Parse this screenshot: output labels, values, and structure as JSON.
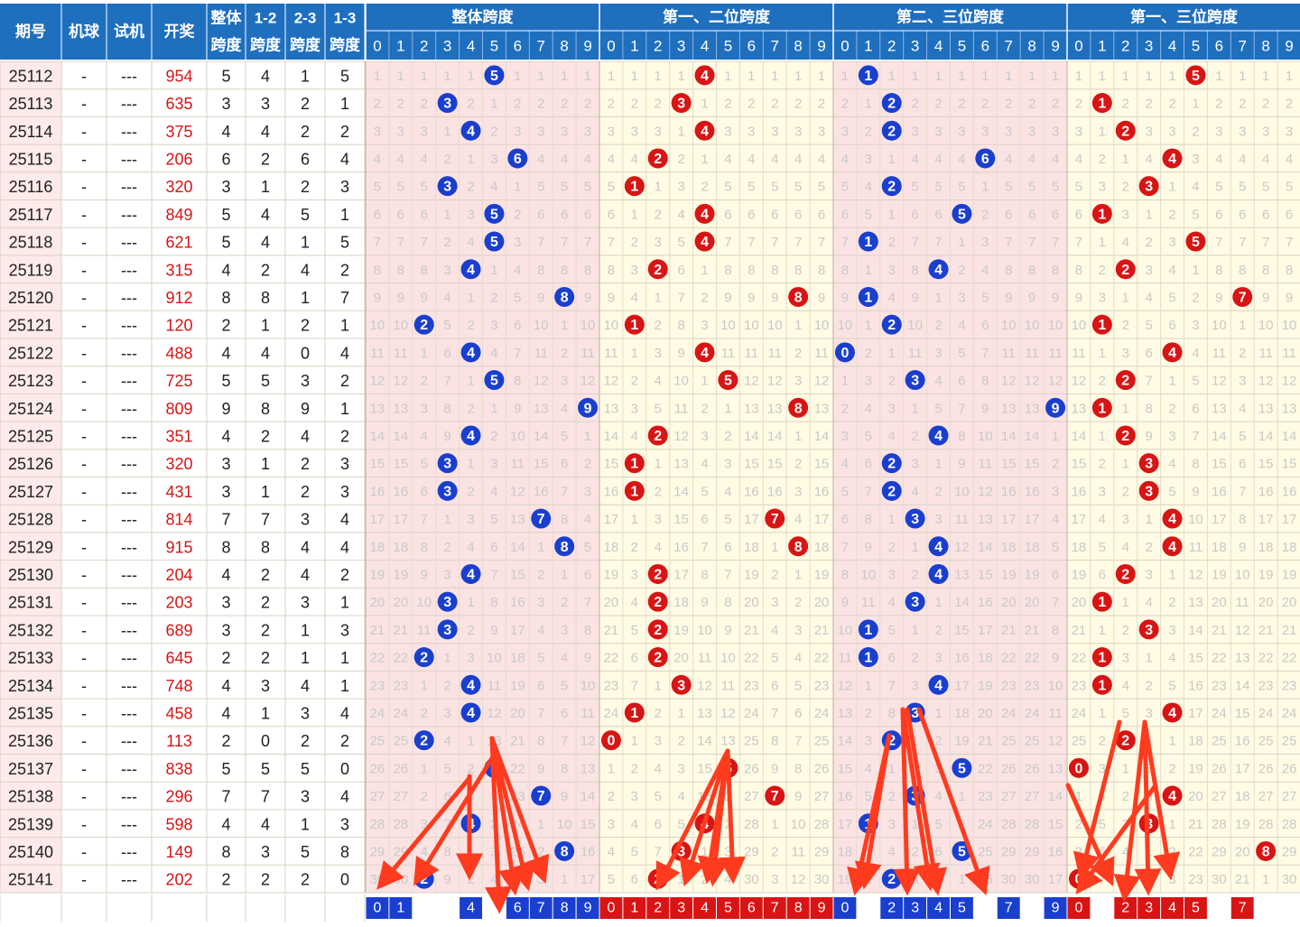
{
  "header": {
    "period": "期号",
    "machine": "机球",
    "trial": "试机",
    "draw": "开奖",
    "overall_span": "整体跨度",
    "span12": "1-2跨度",
    "span23": "2-3跨度",
    "span13": "1-3跨度",
    "group_titles": [
      "整体跨度",
      "第一、二位跨度",
      "第二、三位跨度",
      "第一、三位跨度"
    ],
    "digits": [
      "0",
      "1",
      "2",
      "3",
      "4",
      "5",
      "6",
      "7",
      "8",
      "9"
    ]
  },
  "colors": {
    "header_bg": "#1f6fbf",
    "header_text": "#ffffff",
    "left_col_bg": "#fdeaea",
    "cell_bg_a": "#fbe3e3",
    "cell_bg_b": "#fffbe4",
    "miss_text": "#c9c9c9",
    "blue_ball": "#1a3fcf",
    "red_ball": "#d81414",
    "arrow": "#ff3b1f",
    "draw_text": "#d81414"
  },
  "chart_data": {
    "type": "table",
    "periods": [
      "25112",
      "25113",
      "25114",
      "25115",
      "25116",
      "25117",
      "25118",
      "25119",
      "25120",
      "25121",
      "25122",
      "25123",
      "25124",
      "25125",
      "25126",
      "25127",
      "25128",
      "25129",
      "25130",
      "25131",
      "25132",
      "25133",
      "25134",
      "25135",
      "25136",
      "25137",
      "25138",
      "25139",
      "25140",
      "25141"
    ],
    "machine": [
      "-",
      "-",
      "-",
      "-",
      "-",
      "-",
      "-",
      "-",
      "-",
      "-",
      "-",
      "-",
      "-",
      "-",
      "-",
      "-",
      "-",
      "-",
      "-",
      "-",
      "-",
      "-",
      "-",
      "-",
      "-",
      "-",
      "-",
      "-",
      "-",
      "-"
    ],
    "trial": [
      "---",
      "---",
      "---",
      "---",
      "---",
      "---",
      "---",
      "---",
      "---",
      "---",
      "---",
      "---",
      "---",
      "---",
      "---",
      "---",
      "---",
      "---",
      "---",
      "---",
      "---",
      "---",
      "---",
      "---",
      "---",
      "---",
      "---",
      "---",
      "---",
      "---"
    ],
    "draws": [
      "954",
      "635",
      "375",
      "206",
      "320",
      "849",
      "621",
      "315",
      "912",
      "120",
      "488",
      "725",
      "809",
      "351",
      "320",
      "431",
      "814",
      "915",
      "204",
      "203",
      "689",
      "645",
      "748",
      "458",
      "113",
      "838",
      "296",
      "598",
      "149",
      "202"
    ],
    "overall_span": [
      5,
      3,
      4,
      6,
      3,
      5,
      5,
      4,
      8,
      2,
      4,
      5,
      9,
      4,
      3,
      3,
      7,
      8,
      4,
      3,
      3,
      2,
      4,
      4,
      2,
      5,
      7,
      4,
      8,
      2
    ],
    "span_12": [
      4,
      3,
      4,
      2,
      1,
      4,
      4,
      2,
      8,
      1,
      4,
      5,
      8,
      2,
      1,
      1,
      7,
      8,
      2,
      2,
      2,
      2,
      3,
      1,
      0,
      5,
      7,
      4,
      3,
      2
    ],
    "span_23": [
      1,
      2,
      2,
      6,
      2,
      5,
      1,
      4,
      1,
      2,
      0,
      3,
      9,
      4,
      2,
      2,
      3,
      4,
      4,
      3,
      1,
      1,
      4,
      3,
      2,
      5,
      3,
      1,
      5,
      2
    ],
    "span_13": [
      5,
      1,
      2,
      4,
      3,
      1,
      5,
      2,
      7,
      1,
      4,
      2,
      1,
      2,
      3,
      3,
      4,
      4,
      2,
      1,
      3,
      1,
      1,
      4,
      2,
      0,
      4,
      3,
      8,
      0
    ],
    "bottom_marks": [
      [
        0,
        1,
        4,
        6,
        7,
        8,
        9
      ],
      [
        0,
        1,
        2,
        3,
        4,
        5,
        6,
        7,
        8,
        9
      ],
      [
        0,
        2,
        3,
        4,
        5,
        7,
        9
      ],
      [
        0,
        2,
        3,
        4,
        5,
        7
      ]
    ]
  }
}
